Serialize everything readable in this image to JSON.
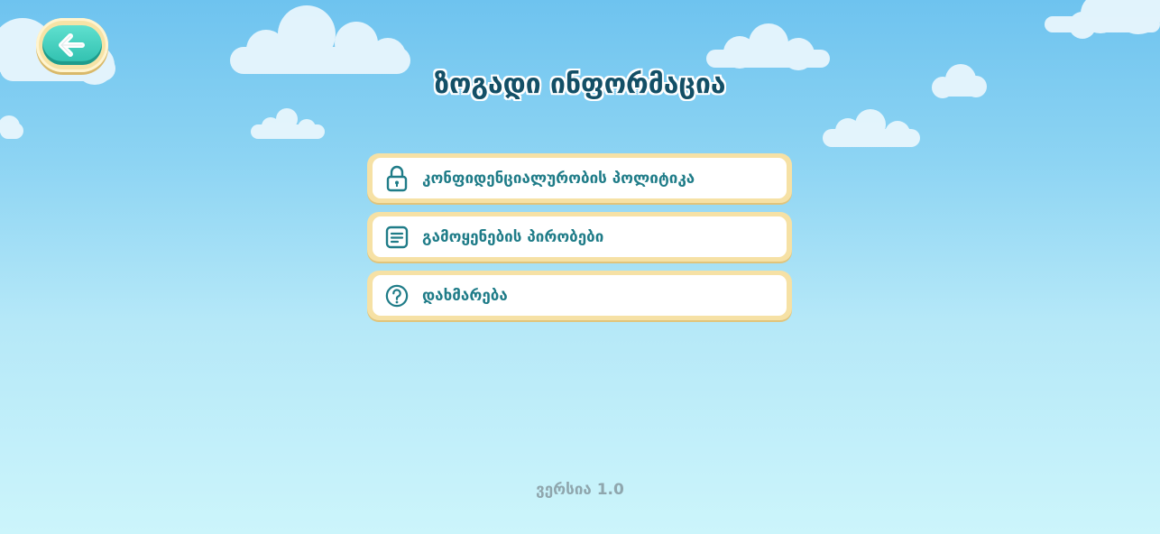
{
  "header": {
    "title": "ზოგადი ინფორმაცია",
    "back_icon": "arrow-left-icon"
  },
  "menu": {
    "items": [
      {
        "label": "კონფიდენციალურობის პოლიტიკა",
        "icon": "lock-icon"
      },
      {
        "label": "გამოყენების პირობები",
        "icon": "document-icon"
      },
      {
        "label": "დახმარება",
        "icon": "question-icon"
      }
    ]
  },
  "footer": {
    "version": "ვერსია 1.0"
  },
  "colors": {
    "accent": "#1f7c88",
    "button_teal": "#2fbfae",
    "frame": "#f6e1a5",
    "title": "#134f66",
    "version_text": "#8fa6ad"
  }
}
